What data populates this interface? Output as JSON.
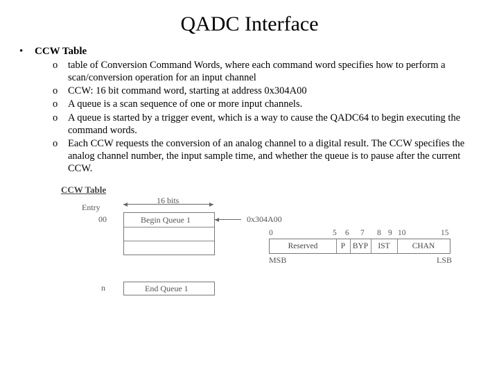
{
  "title": "QADC Interface",
  "bullet": {
    "mark": "•",
    "text": "CCW Table"
  },
  "subs": {
    "mark": "o",
    "items": [
      "table of Conversion Command Words, where each command word specifies how to perform a scan/conversion operation for an input channel",
      "CCW: 16 bit command word, starting at address 0x304A00",
      "A queue is a scan sequence of one or more input channels.",
      "A queue is started by a trigger event, which is a way to cause the QADC64 to begin executing the command words.",
      "Each CCW requests the conversion of an analog channel to a digital result. The CCW specifies the analog channel number, the input sample time, and whether the queue is to pause after the current CCW."
    ]
  },
  "diagram": {
    "heading": "CCW Table",
    "entry_label": "Entry",
    "bits_label": "16 bits",
    "row0_label": "00",
    "row0_text": "Begin Queue 1",
    "row0_addr": "0x304A00",
    "rown_label": "n",
    "rown_text": "End Queue 1",
    "bit_ticks": [
      "0",
      "5",
      "6",
      "7",
      "8",
      "9",
      "10",
      "15"
    ],
    "bit_fields": [
      "Reserved",
      "P",
      "BYP",
      "IST",
      "CHAN"
    ],
    "msb": "MSB",
    "lsb": "LSB"
  }
}
